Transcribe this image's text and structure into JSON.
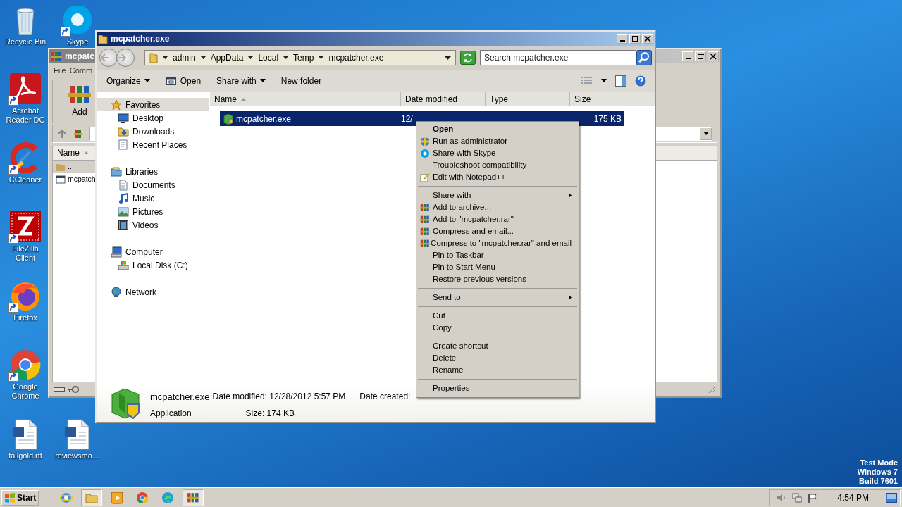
{
  "desktop": {
    "columns": [
      [
        {
          "label": "Recycle Bin",
          "kind": "recycle",
          "shortcut": false
        },
        {
          "label": "Acrobat Reader DC",
          "kind": "acrobat",
          "shortcut": true
        },
        {
          "label": "CCleaner",
          "kind": "ccleaner",
          "shortcut": true
        },
        {
          "label": "FileZilla Client",
          "kind": "filezilla",
          "shortcut": true
        },
        {
          "label": "Firefox",
          "kind": "firefox",
          "shortcut": true
        },
        {
          "label": "Google Chrome",
          "kind": "chrome",
          "shortcut": true
        },
        {
          "label": "fallgold.rtf",
          "kind": "word",
          "shortcut": false
        }
      ],
      [
        {
          "label": "Skype",
          "kind": "skype",
          "shortcut": true
        },
        {
          "label": "reviewsmo…",
          "kind": "word",
          "shortcut": false
        }
      ]
    ]
  },
  "background_window": {
    "title": "mcpatc",
    "menu": [
      "File",
      "Comm"
    ],
    "toolbar_button": "Add",
    "column": "Name",
    "rows": [
      {
        "name": "..",
        "kind": "folder",
        "selected": true
      },
      {
        "name": "mcpatch",
        "kind": "file",
        "selected": false
      }
    ]
  },
  "explorer": {
    "title": "mcpatcher.exe",
    "breadcrumb": [
      "admin",
      "AppData",
      "Local",
      "Temp",
      "mcpatcher.exe"
    ],
    "search": {
      "placeholder": "Search mcpatcher.exe"
    },
    "toolbar": [
      {
        "label": "Organize",
        "kind": "dropdown"
      },
      {
        "label": "Open",
        "kind": "open"
      },
      {
        "label": "Share with",
        "kind": "dropdown"
      },
      {
        "label": "New folder",
        "kind": "plain"
      }
    ],
    "nav": [
      {
        "label": "Favorites",
        "kind": "star",
        "selected": true,
        "children": [
          {
            "label": "Desktop",
            "kind": "desktop",
            "selected": false
          },
          {
            "label": "Downloads",
            "kind": "downloads",
            "selected": false
          },
          {
            "label": "Recent Places",
            "kind": "recent",
            "selected": false
          }
        ]
      },
      {
        "label": "Libraries",
        "kind": "libraries",
        "selected": false,
        "children": [
          {
            "label": "Documents",
            "kind": "documents",
            "selected": false
          },
          {
            "label": "Music",
            "kind": "music",
            "selected": false
          },
          {
            "label": "Pictures",
            "kind": "pictures",
            "selected": false
          },
          {
            "label": "Videos",
            "kind": "videos",
            "selected": false
          }
        ]
      },
      {
        "label": "Computer",
        "kind": "computer",
        "selected": false,
        "children": [
          {
            "label": "Local Disk (C:)",
            "kind": "disk",
            "selected": false
          }
        ]
      },
      {
        "label": "Network",
        "kind": "network",
        "selected": false
      }
    ],
    "columns": [
      "Name",
      "Date modified",
      "Type",
      "Size"
    ],
    "rows": [
      {
        "name": "mcpatcher.exe",
        "date_modified": "12/",
        "size": "175 KB",
        "selected": true
      }
    ],
    "details": {
      "name": "mcpatcher.exe",
      "type": "Application",
      "date_modified_label": "Date modified:",
      "date_modified": "12/28/2012 5:57 PM",
      "size_label": "Size:",
      "size": "174 KB",
      "date_created_label": "Date created:"
    }
  },
  "context_menu": [
    {
      "kind": "item",
      "label": "Open",
      "default": true
    },
    {
      "kind": "admin",
      "label": "Run as administrator"
    },
    {
      "kind": "skype",
      "label": "Share with Skype"
    },
    {
      "kind": "item",
      "label": "Troubleshoot compatibility"
    },
    {
      "kind": "notepad",
      "label": "Edit with Notepad++"
    },
    {
      "kind": "separator"
    },
    {
      "kind": "item",
      "label": "Share with",
      "submenu": true
    },
    {
      "kind": "archive",
      "label": "Add to archive..."
    },
    {
      "kind": "archive",
      "label": "Add to \"mcpatcher.rar\""
    },
    {
      "kind": "archive",
      "label": "Compress and email..."
    },
    {
      "kind": "archive",
      "label": "Compress to \"mcpatcher.rar\" and email"
    },
    {
      "kind": "item",
      "label": "Pin to Taskbar"
    },
    {
      "kind": "item",
      "label": "Pin to Start Menu"
    },
    {
      "kind": "item",
      "label": "Restore previous versions"
    },
    {
      "kind": "separator"
    },
    {
      "kind": "item",
      "label": "Send to",
      "submenu": true
    },
    {
      "kind": "separator"
    },
    {
      "kind": "item",
      "label": "Cut"
    },
    {
      "kind": "item",
      "label": "Copy"
    },
    {
      "kind": "separator"
    },
    {
      "kind": "item",
      "label": "Create shortcut"
    },
    {
      "kind": "item",
      "label": "Delete"
    },
    {
      "kind": "item",
      "label": "Rename"
    },
    {
      "kind": "separator"
    },
    {
      "kind": "item",
      "label": "Properties"
    }
  ],
  "system_notice": [
    "Test Mode",
    "Windows 7",
    "Build 7601"
  ],
  "taskbar": {
    "start": "Start",
    "apps": [
      {
        "kind": "ie",
        "selected": false
      },
      {
        "kind": "explorer",
        "selected": true
      },
      {
        "kind": "media",
        "selected": false
      },
      {
        "kind": "chrome",
        "selected": false
      },
      {
        "kind": "edge",
        "selected": false
      },
      {
        "kind": "winrar",
        "selected": true
      }
    ],
    "clock": "4:54 PM"
  }
}
